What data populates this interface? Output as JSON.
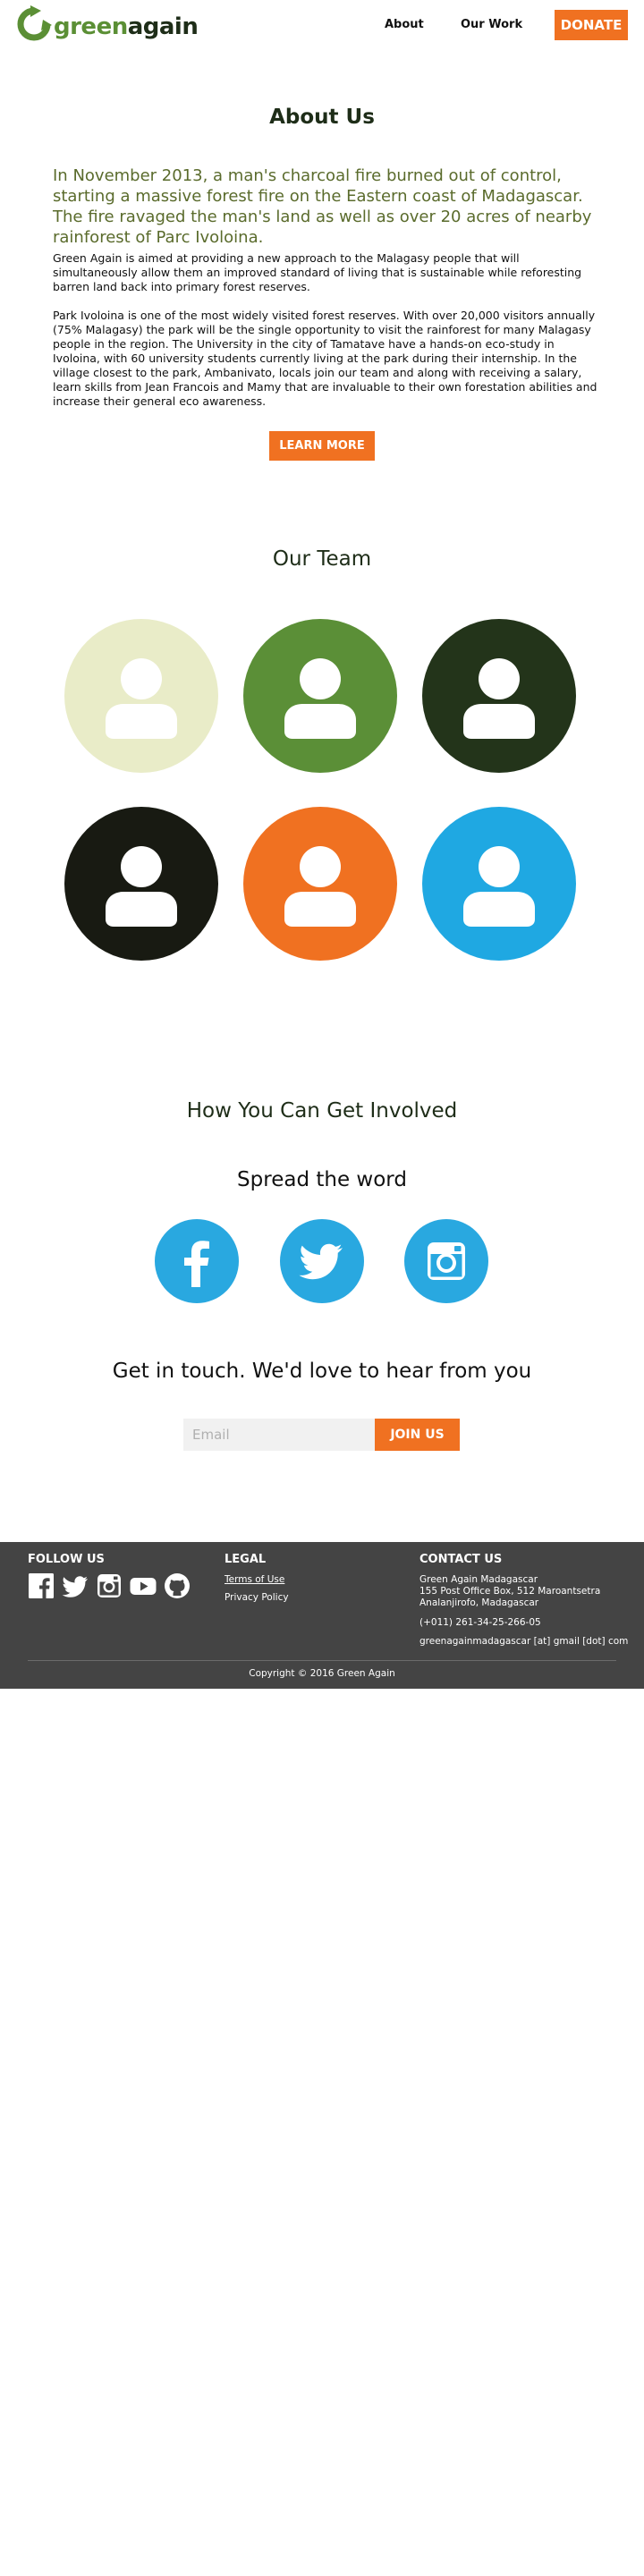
{
  "header": {
    "logo_part1": "green",
    "logo_part2": "again",
    "nav": {
      "about": "About",
      "our_work": "Our Work"
    },
    "donate_label": "DONATE"
  },
  "about": {
    "title": "About Us",
    "lead": "In November 2013, a man's charcoal fire burned out of control, starting a massive forest fire on the Eastern coast of Madagascar. The fire ravaged the man's land as well as over 20 acres of nearby rainforest of Parc Ivoloina.",
    "paragraph1": "Green Again is aimed at providing a new approach to the Malagasy people that will simultaneously allow them an improved standard of living that is sustainable while reforesting barren land back into primary forest reserves.",
    "paragraph2": "Park Ivoloina is one of the most widely visited forest reserves.  With over 20,000 visitors annually (75% Malagasy) the park will be the single opportunity to visit the rainforest for many Malagasy people  in the region. The University in the city of Tamatave have a hands-on eco-study in Ivoloina, with 60 university students currently living at the park during their internship. In the village closest to the park, Ambanivato, locals join our team and along with receiving a salary, learn skills from Jean Francois and Mamy that are invaluable to their own forestation abilities and increase their general eco awareness.",
    "learn_more_label": "LEARN MORE"
  },
  "team": {
    "title": "Our Team",
    "members": [
      {
        "icon": "person-icon",
        "color": "#e9ecc8"
      },
      {
        "icon": "person-icon",
        "color": "#5b8f37"
      },
      {
        "icon": "person-icon",
        "color": "#23341a"
      },
      {
        "icon": "person-icon",
        "color": "#181a12"
      },
      {
        "icon": "person-icon",
        "color": "#f07121"
      },
      {
        "icon": "person-icon",
        "color": "#1fa8e2"
      }
    ]
  },
  "involved": {
    "title": "How You Can Get Involved",
    "spread_title": "Spread the word",
    "social": [
      {
        "icon": "facebook-icon"
      },
      {
        "icon": "twitter-icon"
      },
      {
        "icon": "instagram-icon"
      }
    ],
    "touch_title": "Get in touch. We'd love to hear from you",
    "email_placeholder": "Email",
    "join_label": "JOIN US"
  },
  "footer": {
    "follow_title": "FOLLOW US",
    "follow_icons": [
      "facebook-icon",
      "twitter-icon",
      "instagram-icon",
      "youtube-icon",
      "github-icon"
    ],
    "legal_title": "LEGAL",
    "terms": "Terms of Use",
    "privacy": "Privacy Policy",
    "contact_title": "CONTACT US",
    "address": "Green Again Madagascar\n155 Post Office Box, 512 Maroantsetra\nAnalanjirofo, Madagascar",
    "phone": "(+011) 261-34-25-266-05",
    "email": "greenagainmadagascar [at] gmail [dot] com",
    "copyright": "Copyright © 2016 Green Again"
  },
  "colors": {
    "brand_green": "#5b8f35",
    "brand_dark": "#1e2d18",
    "accent_orange": "#f07121",
    "social_blue": "#29a8e0",
    "footer_bg": "#444444"
  }
}
